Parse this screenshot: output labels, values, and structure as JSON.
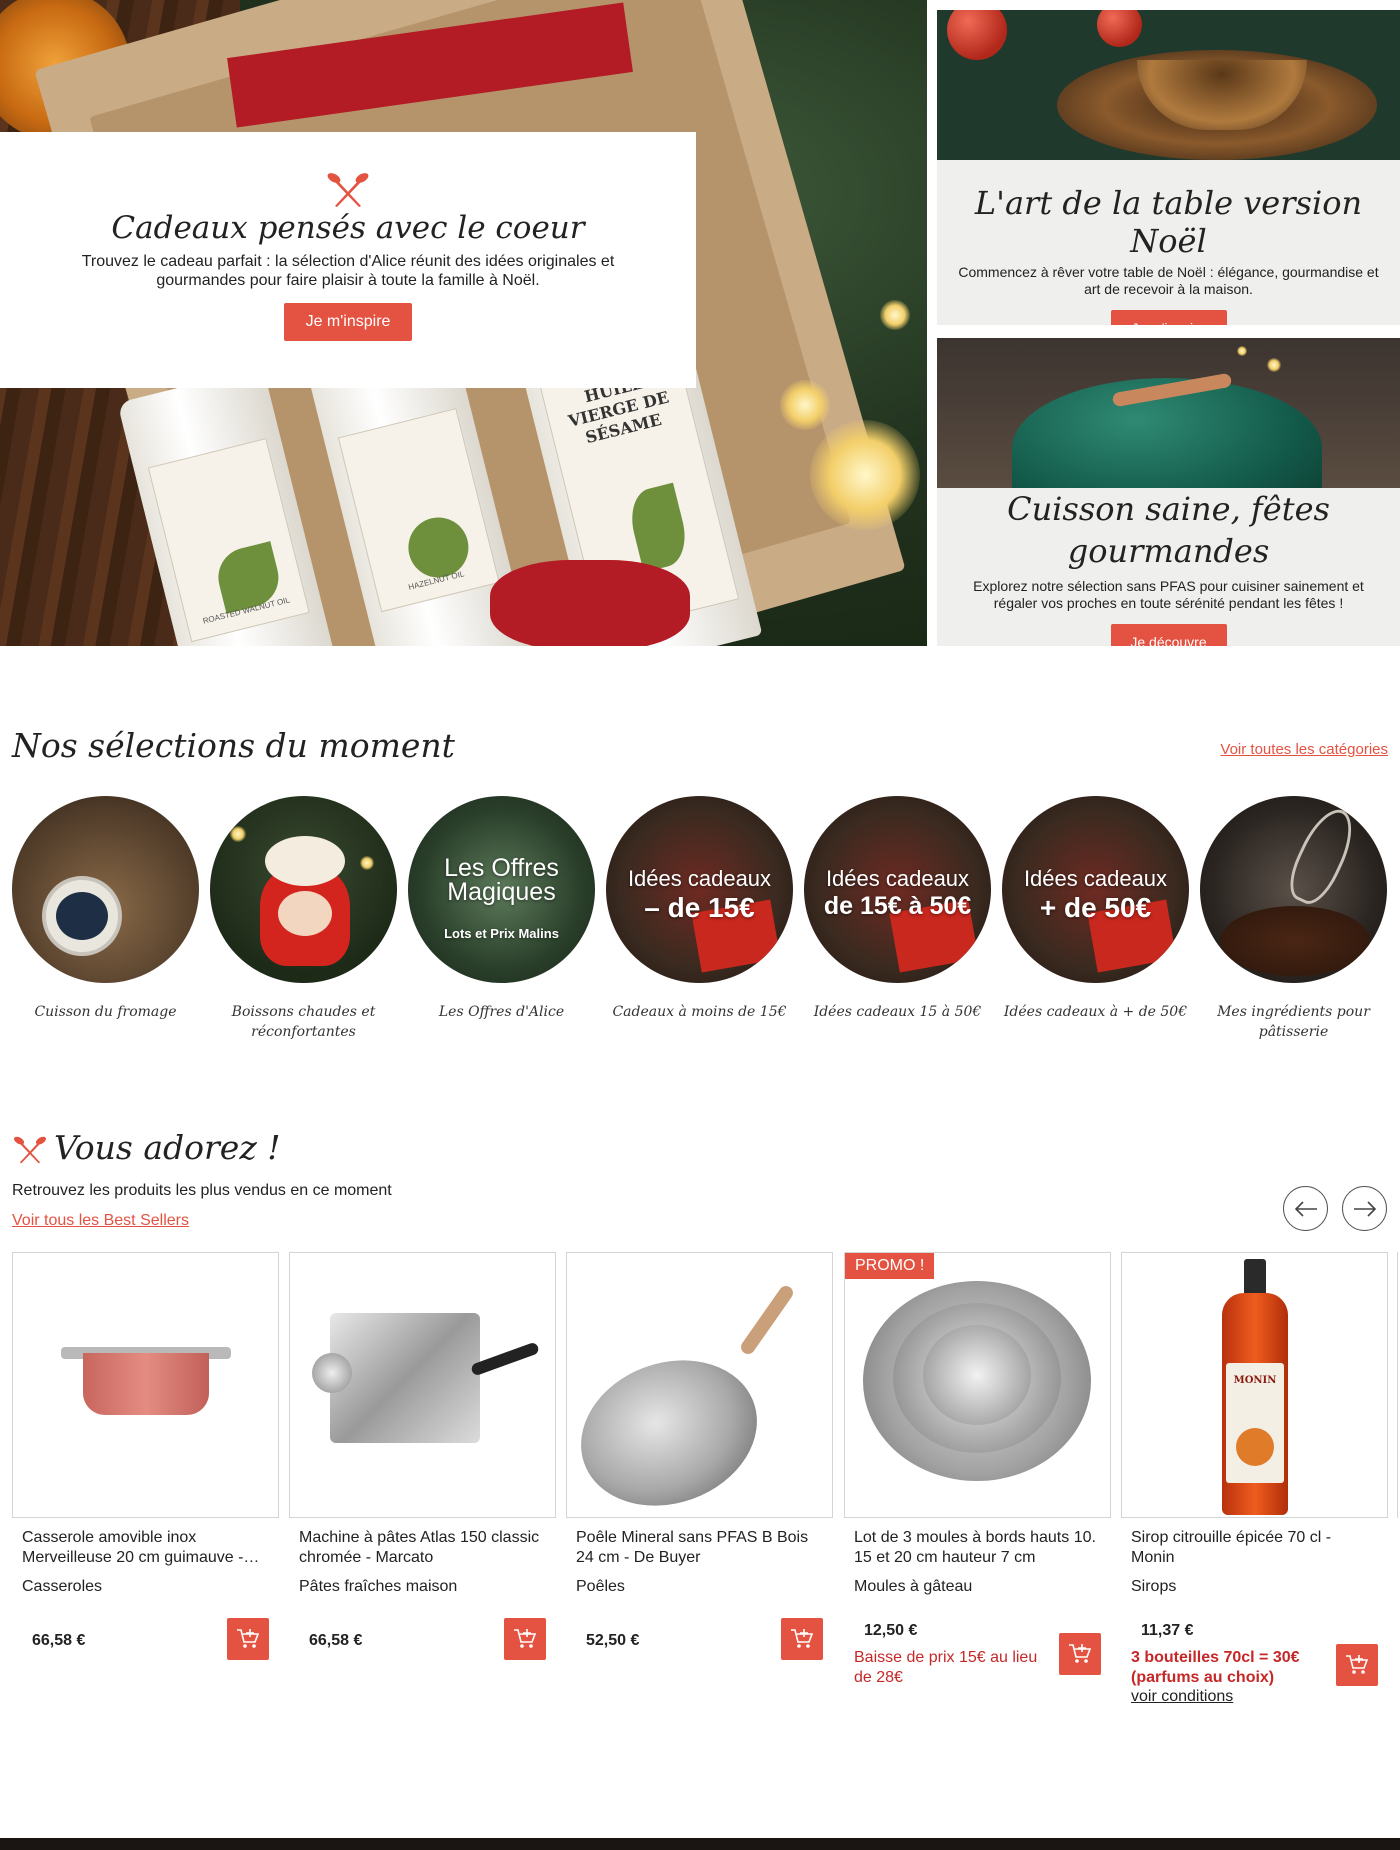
{
  "hero": {
    "title": "Cadeaux pensés avec le coeur",
    "text": "Trouvez le cadeau parfait : la sélection d'Alice réunit des idées originales et gourmandes pour faire plaisir à toute la famille à Noël.",
    "button": "Je m'inspire",
    "bottle_labels": [
      "ROASTED WALNUT OIL",
      "HAZELNUT OIL",
      "HUILE VIERGE DE SÉSAME"
    ]
  },
  "side1": {
    "title": "L'art de la table version Noël",
    "text": "Commencez à rêver votre table de Noël : élégance, gourmandise et art de recevoir à la maison.",
    "button": "Je m'inspire"
  },
  "side2": {
    "title": "Cuisson saine, fêtes gourmandes",
    "text": "Explorez notre sélection sans PFAS pour cuisiner sainement et régaler vos proches en toute sérénité pendant les fêtes !",
    "button": "Je découvre"
  },
  "selections": {
    "title": "Nos sélections du moment",
    "link": "Voir toutes les catégories",
    "items": [
      {
        "caption": "Cuisson du fromage",
        "overlay": ""
      },
      {
        "caption": "Boissons chaudes et réconfortantes",
        "overlay": ""
      },
      {
        "caption": "Les Offres d'Alice",
        "overlay": "Les Offres Magiques",
        "overlay2": "Lots et Prix Malins"
      },
      {
        "caption": "Cadeaux à moins de 15€",
        "overlay": "Idées cadeaux",
        "overlay2": "– de 15€"
      },
      {
        "caption": "Idées cadeaux 15 à 50€",
        "overlay": "Idées cadeaux",
        "overlay2": "de 15€ à 50€"
      },
      {
        "caption": "Idées cadeaux à + de 50€",
        "overlay": "Idées cadeaux",
        "overlay2": "+ de 50€"
      },
      {
        "caption": "Mes ingrédients pour pâtisserie",
        "overlay": ""
      }
    ]
  },
  "bestsellers": {
    "title": "Vous adorez !",
    "subtitle": "Retrouvez les produits les plus vendus en ce moment",
    "link": "Voir tous les Best Sellers",
    "products": [
      {
        "name": "Casserole amovible inox Merveilleuse 20 cm guimauve -…",
        "category": "Casseroles",
        "price": "66,58 €"
      },
      {
        "name": "Machine à pâtes Atlas 150 classic chromée - Marcato",
        "category": "Pâtes fraîches maison",
        "price": "66,58 €"
      },
      {
        "name": "Poêle Mineral sans PFAS B Bois 24 cm - De Buyer",
        "category": "Poêles",
        "price": "52,50 €"
      },
      {
        "name": "Lot de 3 moules à bords hauts 10. 15 et 20 cm hauteur 7 cm",
        "category": "Moules à gâteau",
        "price": "12,50 €",
        "badge": "PROMO !",
        "promo": "Baisse de prix 15€ au lieu de 28€"
      },
      {
        "name": "Sirop citrouille épicée 70 cl - Monin",
        "category": "Sirops",
        "price": "11,37 €",
        "promo": "3 bouteilles 70cl = 30€ (parfums au choix)",
        "conditions": "voir conditions",
        "bottle_brand": "MONIN"
      }
    ]
  },
  "colors": {
    "accent": "#e45241",
    "promo_text": "#c62828",
    "panel": "#efefee"
  }
}
